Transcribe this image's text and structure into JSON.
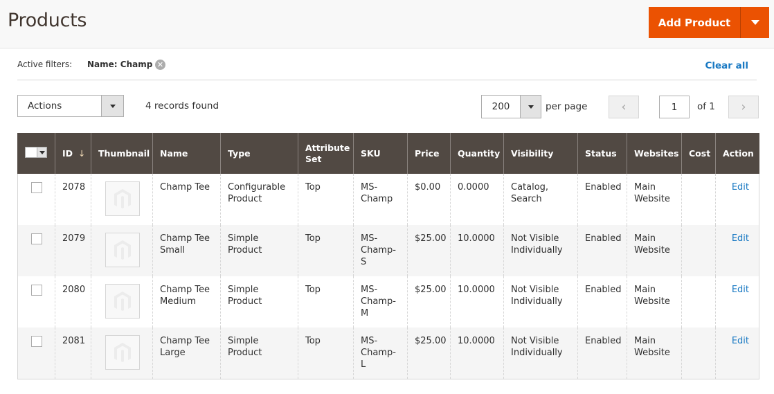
{
  "header": {
    "title": "Products",
    "add_button_label": "Add Product"
  },
  "filters": {
    "label": "Active filters:",
    "active": [
      {
        "text": "Name: Champ"
      }
    ],
    "clear_all_label": "Clear all"
  },
  "toolbar": {
    "actions_label": "Actions",
    "records_found": "4 records found",
    "per_page_value": "200",
    "per_page_label": "per page",
    "current_page": "1",
    "page_of": "of 1"
  },
  "grid": {
    "columns": [
      "",
      "ID",
      "Thumbnail",
      "Name",
      "Type",
      "Attribute Set",
      "SKU",
      "Price",
      "Quantity",
      "Visibility",
      "Status",
      "Websites",
      "Cost",
      "Action"
    ],
    "sort": {
      "column": "ID",
      "direction": "desc-arrow"
    },
    "rows": [
      {
        "id": "2078",
        "name": "Champ Tee",
        "type": "Configurable Product",
        "attribute_set": "Top",
        "sku": "MS-Champ",
        "price": "$0.00",
        "quantity": "0.0000",
        "visibility": "Catalog, Search",
        "status": "Enabled",
        "websites": "Main Website",
        "cost": "",
        "action": "Edit"
      },
      {
        "id": "2079",
        "name": "Champ Tee Small",
        "type": "Simple Product",
        "attribute_set": "Top",
        "sku": "MS-Champ-S",
        "price": "$25.00",
        "quantity": "10.0000",
        "visibility": "Not Visible Individually",
        "status": "Enabled",
        "websites": "Main Website",
        "cost": "",
        "action": "Edit"
      },
      {
        "id": "2080",
        "name": "Champ Tee Medium",
        "type": "Simple Product",
        "attribute_set": "Top",
        "sku": "MS-Champ-M",
        "price": "$25.00",
        "quantity": "10.0000",
        "visibility": "Not Visible Individually",
        "status": "Enabled",
        "websites": "Main Website",
        "cost": "",
        "action": "Edit"
      },
      {
        "id": "2081",
        "name": "Champ Tee Large",
        "type": "Simple Product",
        "attribute_set": "Top",
        "sku": "MS-Champ-L",
        "price": "$25.00",
        "quantity": "10.0000",
        "visibility": "Not Visible Individually",
        "status": "Enabled",
        "websites": "Main Website",
        "cost": "",
        "action": "Edit"
      }
    ]
  },
  "colors": {
    "accent": "#eb5202",
    "header_bg": "#514943",
    "link": "#1979c3"
  }
}
